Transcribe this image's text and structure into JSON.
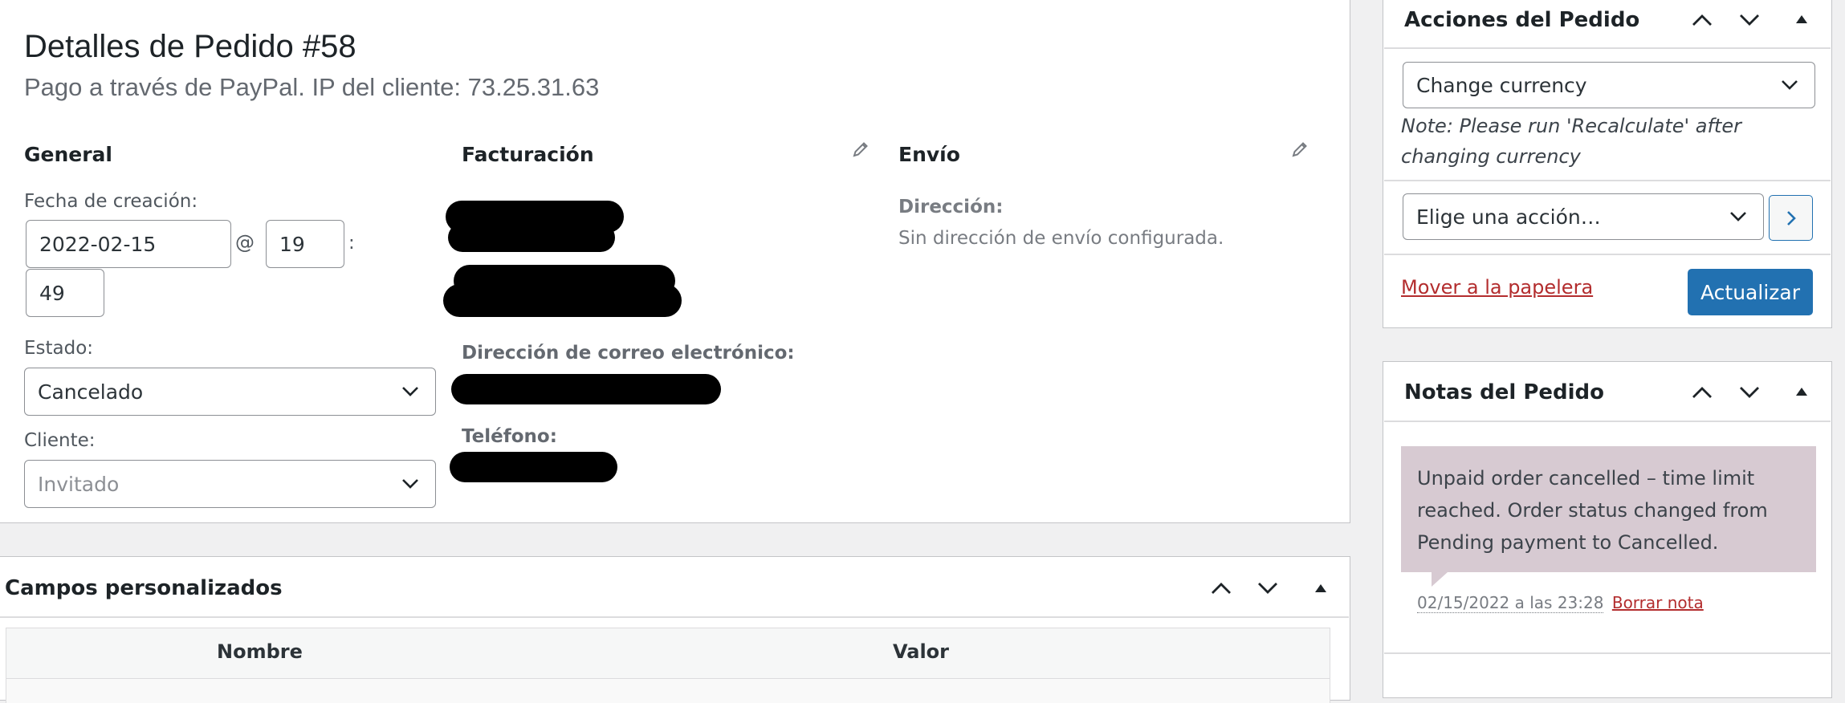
{
  "order": {
    "title": "Detalles de Pedido #58",
    "subtitle": "Pago a través de PayPal. IP del cliente: 73.25.31.63",
    "general": {
      "heading": "General",
      "date_label": "Fecha de creación:",
      "date_value": "2022-02-15",
      "at": "@",
      "hour_value": "19",
      "colon": ":",
      "minute_value": "49",
      "status_label": "Estado:",
      "status_value": "Cancelado",
      "customer_label": "Cliente:",
      "customer_placeholder": "Invitado"
    },
    "billing": {
      "heading": "Facturación",
      "email_label": "Dirección de correo electrónico:",
      "phone_label": "Teléfono:"
    },
    "shipping": {
      "heading": "Envío",
      "address_label": "Dirección:",
      "address_value": "Sin dirección de envío configurada."
    }
  },
  "custom_fields": {
    "heading": "Campos personalizados",
    "columns": [
      "Nombre",
      "Valor"
    ]
  },
  "actions_box": {
    "heading": "Acciones del Pedido",
    "currency_select": "Change currency",
    "note": "Note: Please run 'Recalculate' after changing currency",
    "action_select": "Elige una acción…",
    "trash_link": "Mover a la papelera",
    "update_button": "Actualizar"
  },
  "notes_box": {
    "heading": "Notas del Pedido",
    "note_text": "Unpaid order cancelled – time limit reached. Order status changed from Pending payment to Cancelled.",
    "note_date": "02/15/2022 a las 23:28",
    "delete_link": "Borrar nota"
  },
  "colors": {
    "primary": "#2271b1",
    "link_red": "#b32d2e",
    "note_bg": "#d7cad2"
  }
}
